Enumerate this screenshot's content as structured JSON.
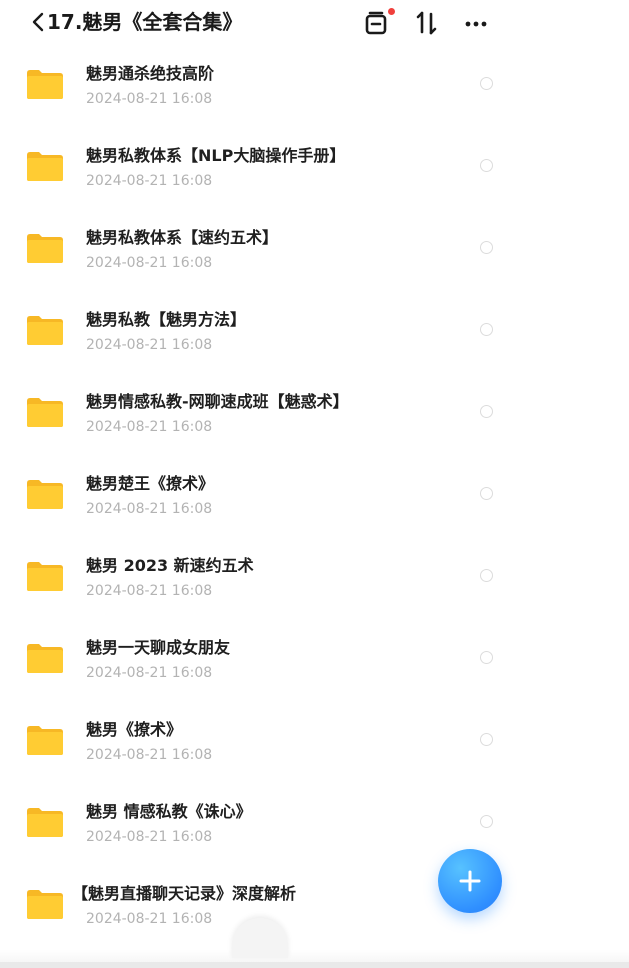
{
  "header": {
    "title": "17.魅男《全套合集》",
    "icons": [
      "back-chevron-icon",
      "clipboard-icon",
      "sort-icon",
      "more-icon"
    ],
    "badge_color": "#f0403c"
  },
  "files": [
    {
      "name": "魅男通杀绝技高阶",
      "date": "2024-08-21 16:08"
    },
    {
      "name": "魅男私教体系【NLP大脑操作手册】",
      "date": "2024-08-21 16:08"
    },
    {
      "name": "魅男私教体系【速约五术】",
      "date": "2024-08-21 16:08"
    },
    {
      "name": "魅男私教【魅男方法】",
      "date": "2024-08-21 16:08"
    },
    {
      "name": "魅男情感私教-网聊速成班【魅惑术】",
      "date": "2024-08-21 16:08"
    },
    {
      "name": "魅男楚王《撩术》",
      "date": "2024-08-21 16:08"
    },
    {
      "name": "魅男 2023 新速约五术",
      "date": "2024-08-21 16:08"
    },
    {
      "name": "魅男一天聊成女朋友",
      "date": "2024-08-21 16:08"
    },
    {
      "name": "魅男《撩术》",
      "date": "2024-08-21 16:08"
    },
    {
      "name": "魅男 情感私教《诛心》",
      "date": "2024-08-21 16:08"
    },
    {
      "name": "【魅男直播聊天记录》深度解析",
      "date": "2024-08-21 16:08"
    }
  ],
  "fab": {
    "icon": "plus-icon",
    "color": "#2f8fff"
  },
  "folder_color": "#ffcc33"
}
